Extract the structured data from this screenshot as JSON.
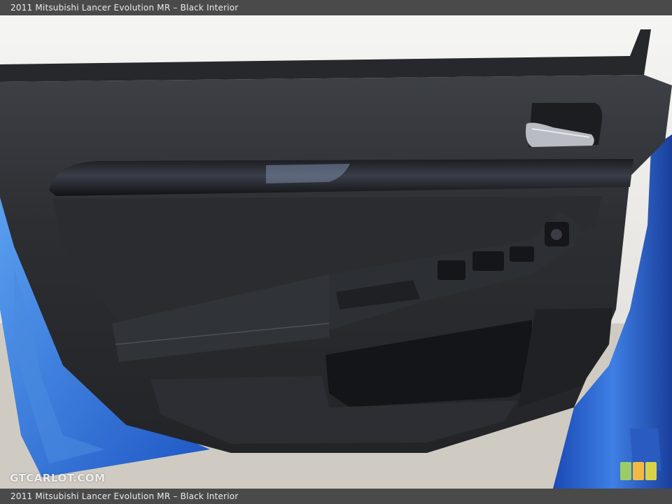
{
  "caption": {
    "top": "2011 Mitsubishi Lancer Evolution MR – Black Interior",
    "bottom": "2011 Mitsubishi Lancer Evolution MR – Black Interior"
  },
  "watermark": "GTCARLOT.COM",
  "colors": {
    "car_blue": "#2f6fd6",
    "panel_dark": "#2b2d30",
    "badge_green": "#9ccc65",
    "badge_orange": "#f4b942",
    "badge_yellow": "#d7d24a"
  }
}
